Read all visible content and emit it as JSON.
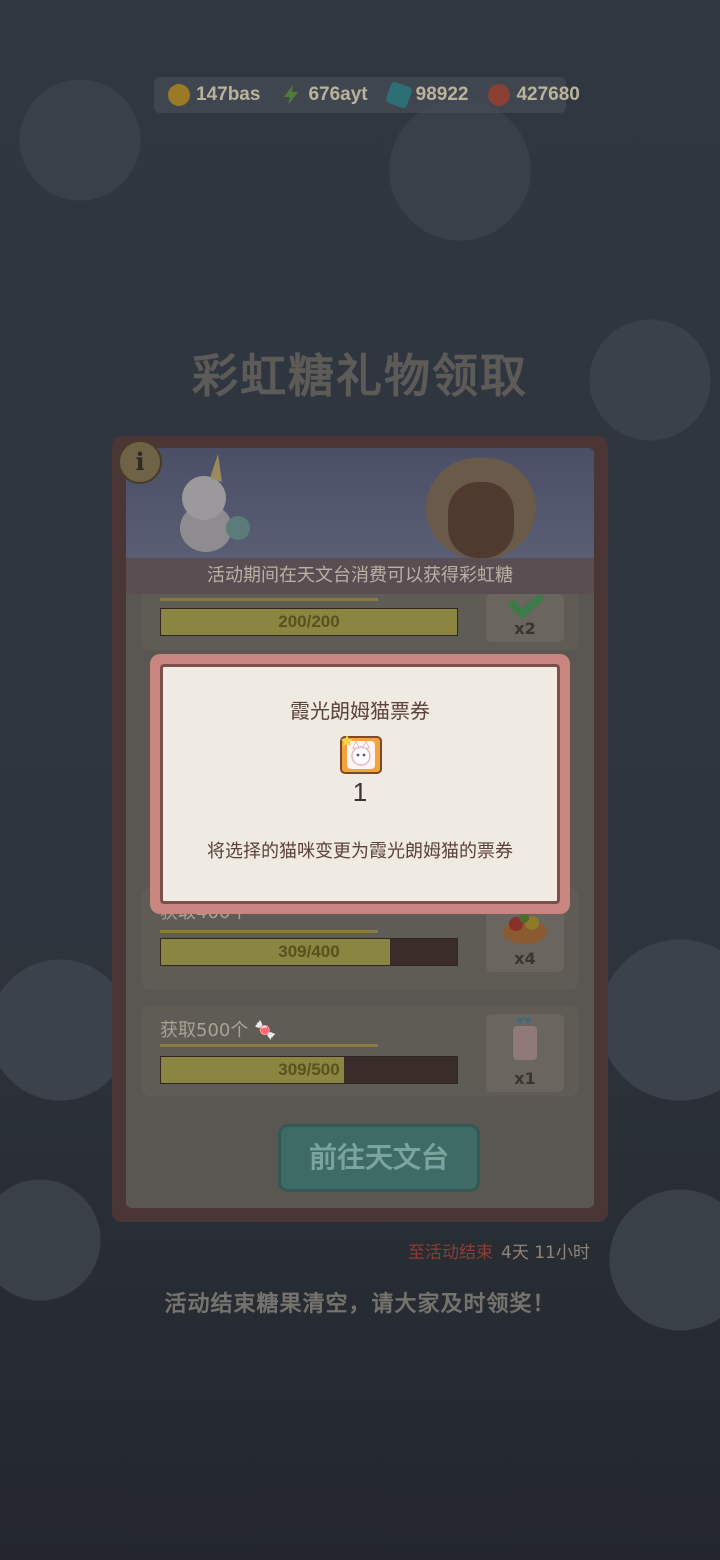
{
  "currencies": [
    {
      "icon": "gold-coin-icon",
      "value": "147bas",
      "color": "#b88c20"
    },
    {
      "icon": "lightning-icon",
      "value": "676ayt",
      "color": "#4a8a3a"
    },
    {
      "icon": "gem-icon",
      "value": "98922",
      "color": "#2f7f86"
    },
    {
      "icon": "cookie-icon",
      "value": "427680",
      "color": "#9a4a3a"
    }
  ],
  "title": "彩虹糖礼物领取",
  "banner_caption": "活动期间在天文台消费可以获得彩虹糖",
  "rows": [
    {
      "label": "",
      "progress_text": "200/200",
      "progress": 1.0,
      "reward_qty": "x2",
      "claimed": true
    },
    {
      "label": "获取400个",
      "progress_text": "309/400",
      "progress": 0.7725,
      "reward_qty": "x4"
    },
    {
      "label": "获取500个",
      "progress_text": "309/500",
      "progress": 0.618,
      "reward_qty": "x1"
    }
  ],
  "goto_button": "前往天文台",
  "countdown": {
    "label": "至活动结束",
    "time": "4天 11小时"
  },
  "notice": "活动结束糖果清空，请大家及时领奖！",
  "modal": {
    "title": "霞光朗姆猫票券",
    "count": "1",
    "description": "将选择的猫咪变更为霞光朗姆猫的票券"
  },
  "info_icon": "i"
}
